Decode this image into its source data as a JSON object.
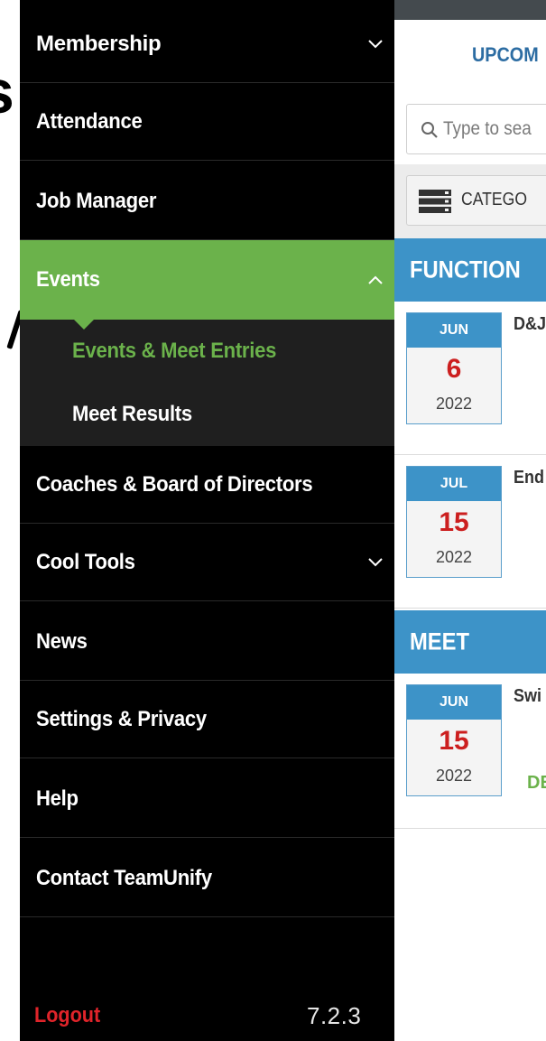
{
  "background_page": {
    "heading_fragment": "s"
  },
  "menu": {
    "items": [
      {
        "key": "membership",
        "label": "Membership",
        "chevron": "down"
      },
      {
        "key": "attendance",
        "label": "Attendance"
      },
      {
        "key": "job_manager",
        "label": "Job Manager"
      },
      {
        "key": "events",
        "label": "Events",
        "chevron": "up",
        "active": true
      },
      {
        "key": "coaches",
        "label": "Coaches & Board of Directors"
      },
      {
        "key": "cool_tools",
        "label": "Cool Tools",
        "chevron": "down"
      },
      {
        "key": "news",
        "label": "News"
      },
      {
        "key": "settings",
        "label": "Settings & Privacy"
      },
      {
        "key": "help",
        "label": "Help"
      },
      {
        "key": "contact",
        "label": "Contact TeamUnify"
      }
    ],
    "events_submenu": [
      {
        "label": "Events & Meet Entries",
        "active": true
      },
      {
        "label": "Meet Results"
      }
    ],
    "logout_label": "Logout",
    "version": "7.2.3"
  },
  "content": {
    "heading": "UPCOM",
    "search_placeholder": "Type to sea",
    "category_label": "CATEGO",
    "sections": [
      {
        "title": "FUNCTION",
        "events": [
          {
            "month": "JUN",
            "day": "6",
            "year": "2022",
            "title": "D&J"
          },
          {
            "month": "JUL",
            "day": "15",
            "year": "2022",
            "title": "End"
          }
        ]
      },
      {
        "title": "MEET",
        "events": [
          {
            "month": "JUN",
            "day": "15",
            "year": "2022",
            "title": "Swi",
            "tag": "DE"
          }
        ]
      }
    ]
  },
  "colors": {
    "drawer_bg": "#000000",
    "active_green": "#6bb24b",
    "submenu_bg": "#1f1f1f",
    "logout_red": "#e0242a",
    "section_blue": "#3d93c8",
    "heading_blue": "#2d6da3",
    "date_red": "#cc1f1f"
  }
}
